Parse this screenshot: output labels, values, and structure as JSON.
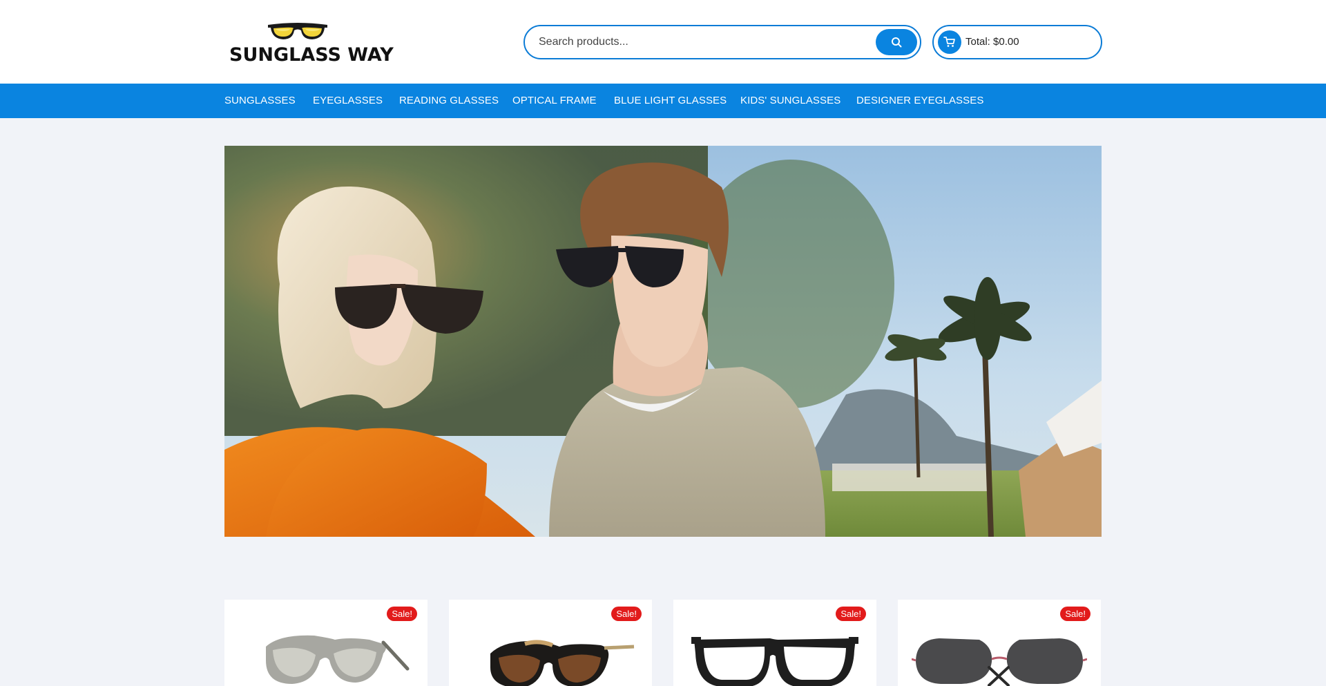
{
  "header": {
    "logo_text": "SUNGLASS WAY",
    "search": {
      "placeholder": "Search products..."
    },
    "cart": {
      "total_label": "Total: $0.00"
    }
  },
  "nav": {
    "items": [
      "SUNGLASSES",
      "EYEGLASSES",
      "READING GLASSES",
      "OPTICAL FRAME",
      "BLUE LIGHT GLASSES",
      "KIDS' SUNGLASSES",
      "DESIGNER EYEGLASSES"
    ]
  },
  "products": [
    {
      "badge": "Sale!"
    },
    {
      "badge": "Sale!"
    },
    {
      "badge": "Sale!"
    },
    {
      "badge": "Sale!"
    }
  ],
  "colors": {
    "accent": "#0a84e0",
    "sale": "#e21b1b",
    "page_bg": "#f1f3f8"
  },
  "icons": {
    "search": "search-icon",
    "cart": "cart-icon"
  }
}
